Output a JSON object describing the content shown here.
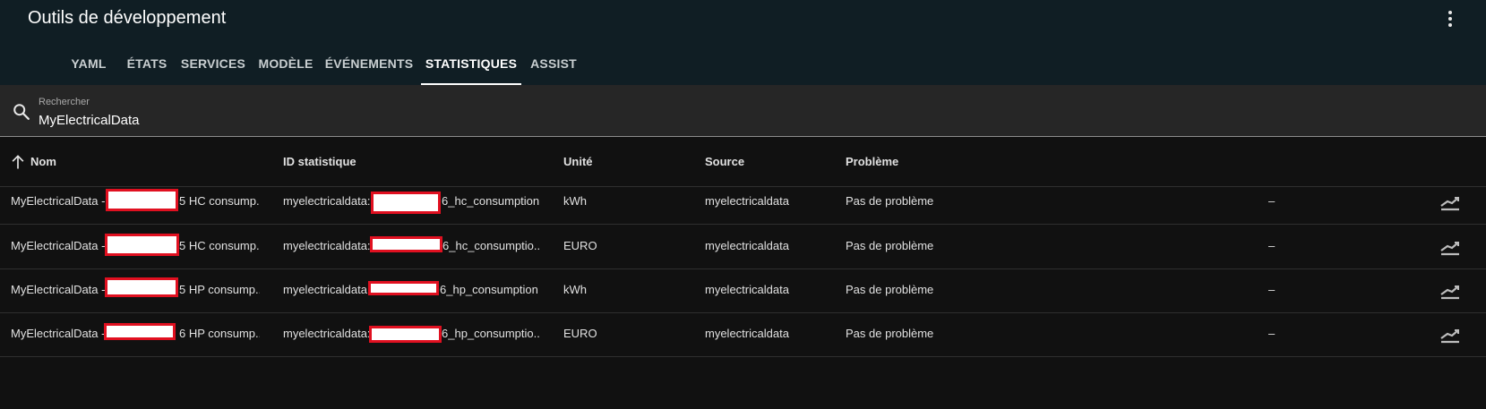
{
  "app": {
    "title": "Outils de développement"
  },
  "tabs": [
    {
      "label": "YAML"
    },
    {
      "label": "États"
    },
    {
      "label": "Services"
    },
    {
      "label": "Modèle"
    },
    {
      "label": "Événements"
    },
    {
      "label": "Statistiques"
    },
    {
      "label": "Assist"
    }
  ],
  "search": {
    "label": "Rechercher",
    "value": "MyElectricalData"
  },
  "table": {
    "headers": {
      "name": "Nom",
      "statistic_id": "ID statistique",
      "unit": "Unité",
      "source": "Source",
      "issue": "Problème"
    },
    "rows": [
      {
        "name_prefix": "MyElectricalData - 1",
        "name_suffix": "5 HC consump...",
        "id_prefix": "myelectricaldata:1",
        "id_suffix": "6_hc_consumption",
        "unit": "kWh",
        "source": "myelectricaldata",
        "issue": "Pas de problème",
        "extra": "–"
      },
      {
        "name_prefix": "MyElectricalData - 1",
        "name_suffix": "5 HC consump...",
        "id_prefix": "myelectricaldata:1",
        "id_suffix": "6_hc_consumptio...",
        "unit": "EURO",
        "source": "myelectricaldata",
        "issue": "Pas de problème",
        "extra": "–"
      },
      {
        "name_prefix": "MyElectricalData - 1",
        "name_suffix": "5 HP consump...",
        "id_prefix": "myelectricaldata:1",
        "id_suffix": "6_hp_consumption",
        "unit": "kWh",
        "source": "myelectricaldata",
        "issue": "Pas de problème",
        "extra": "–"
      },
      {
        "name_prefix": "MyElectricalData - 1",
        "name_suffix": "6 HP consump...",
        "id_prefix": "myelectricaldata:1",
        "id_suffix": "6_hp_consumptio...",
        "unit": "EURO",
        "source": "myelectricaldata",
        "issue": "Pas de problème",
        "extra": "–"
      }
    ]
  },
  "colors": {
    "header_bg": "#101e24",
    "page_bg": "#111111",
    "search_bg": "#262626",
    "redaction_border": "#e01020",
    "active_tab": "#ffffff"
  },
  "icons": {
    "menu": "dots-vertical-icon",
    "search": "magnify-icon",
    "sort": "arrow-up-icon",
    "row_action": "chart-line-icon"
  }
}
